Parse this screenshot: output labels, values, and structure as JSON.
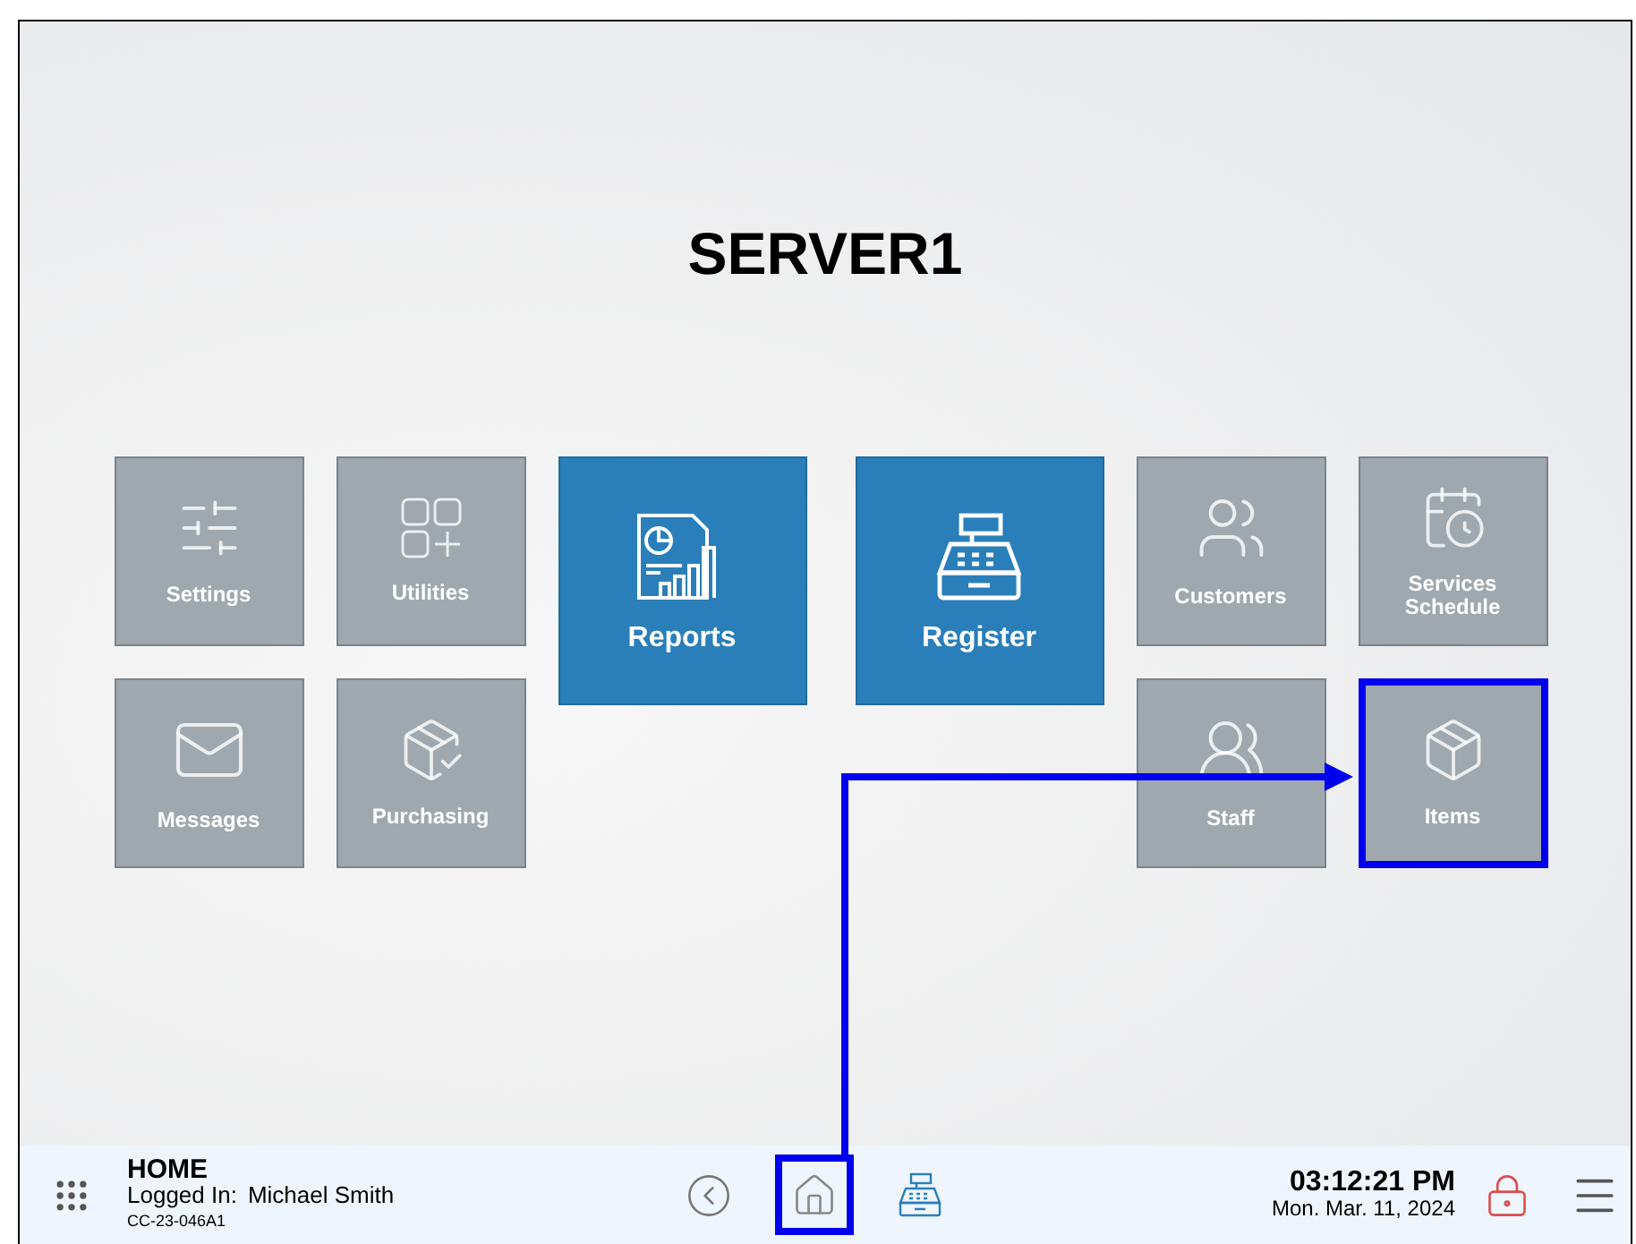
{
  "title": "SERVER1",
  "tiles": [
    {
      "label": "Settings",
      "kind": "small",
      "highlighted": false
    },
    {
      "label": "Utilities",
      "kind": "small",
      "highlighted": false
    },
    {
      "label": "Reports",
      "kind": "large",
      "highlighted": false
    },
    {
      "label": "Register",
      "kind": "large",
      "highlighted": false
    },
    {
      "label": "Customers",
      "kind": "small",
      "highlighted": false
    },
    {
      "label": "Services Schedule",
      "kind": "small",
      "highlighted": false
    },
    {
      "label": "Messages",
      "kind": "small",
      "highlighted": false
    },
    {
      "label": "Purchasing",
      "kind": "small",
      "highlighted": false
    },
    {
      "label": "Staff",
      "kind": "small",
      "highlighted": false
    },
    {
      "label": "Items",
      "kind": "small",
      "highlighted": true
    }
  ],
  "status_bar": {
    "screen": "HOME",
    "logged_in_label": "Logged In:",
    "user": "Michael Smith",
    "terminal": "CC-23-046A1",
    "home_highlighted": true,
    "time": "03:12:21 PM",
    "date": "Mon. Mar. 11, 2024"
  }
}
